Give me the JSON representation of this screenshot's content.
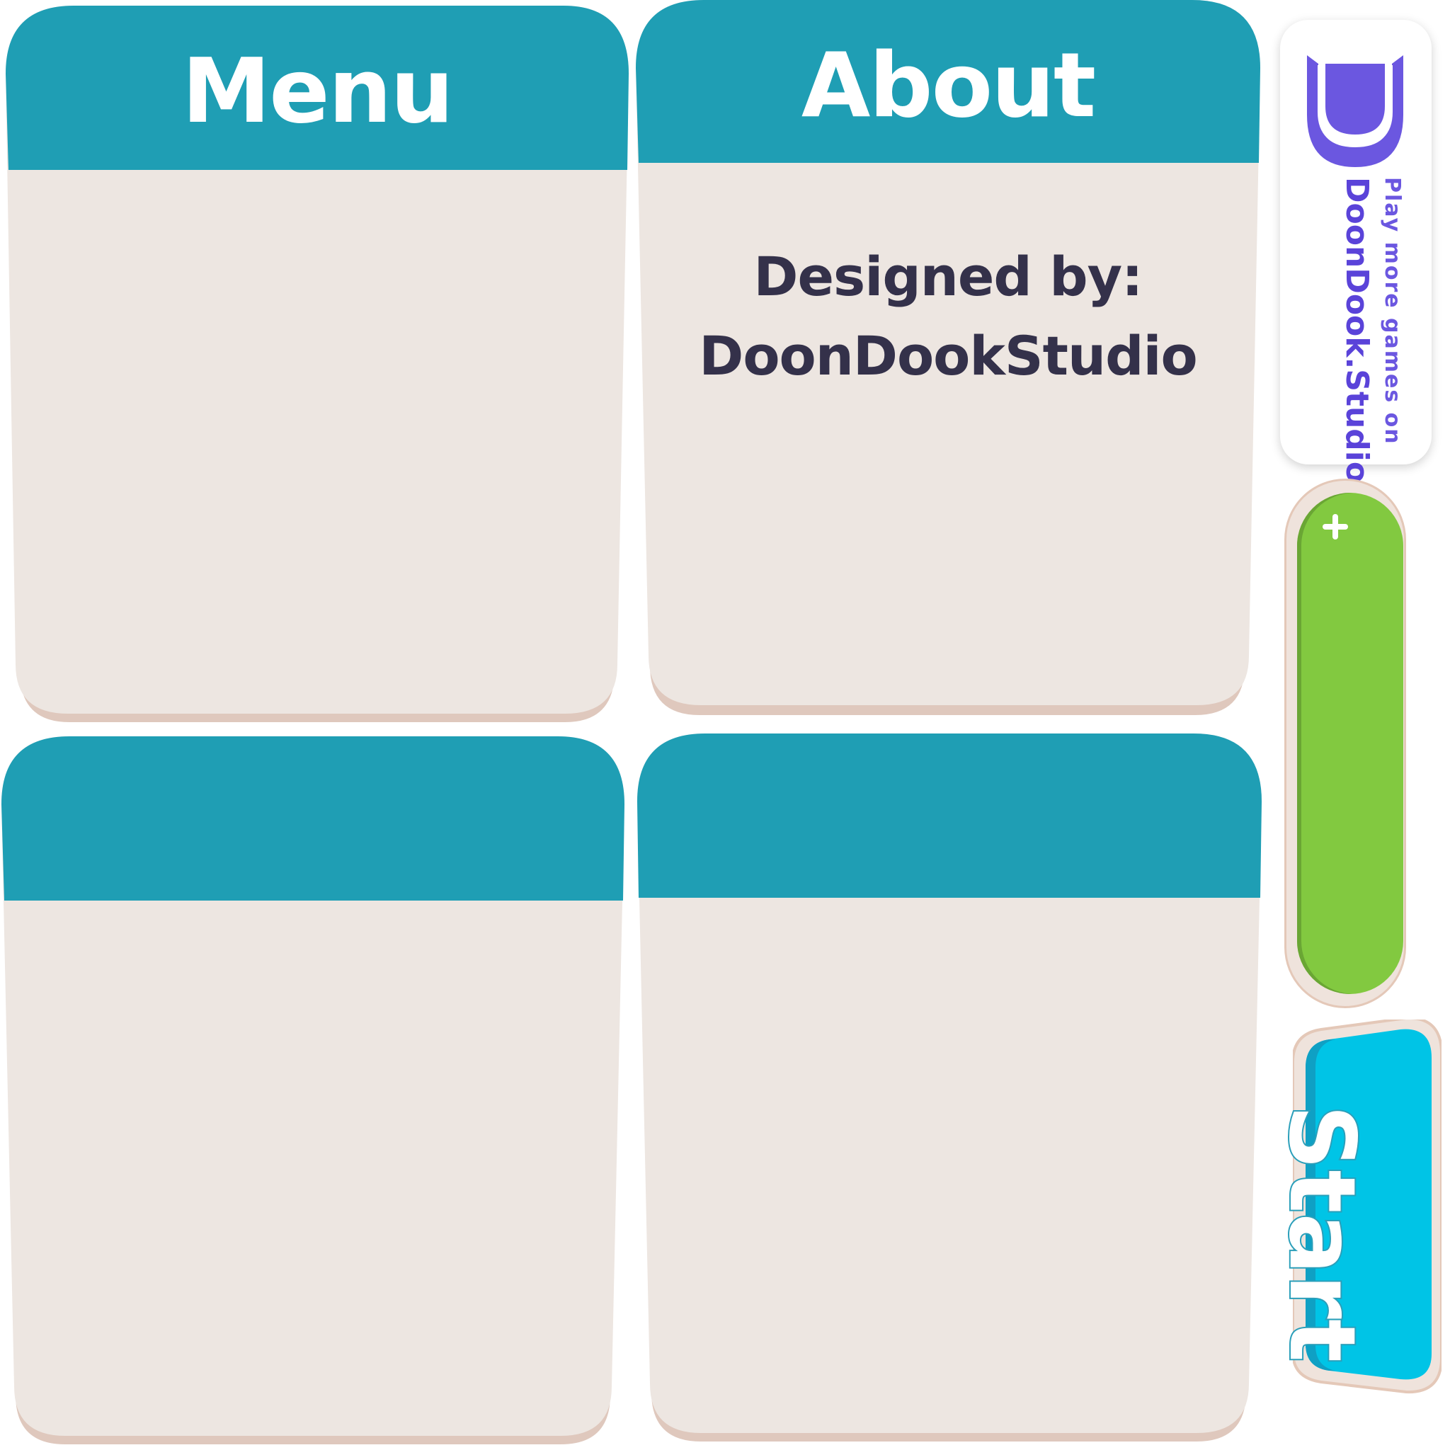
{
  "panels": {
    "menu": {
      "title": "Menu"
    },
    "about": {
      "title": "About",
      "designed_line1": "Designed by:",
      "designed_line2": "DoonDookStudio"
    },
    "panel_bottom_left": {
      "title": ""
    },
    "panel_bottom_right": {
      "title": ""
    }
  },
  "promo": {
    "line1": "Play more games on",
    "line2": "DoonDook.Studio"
  },
  "side_button": {
    "icon": "plus-icon"
  },
  "start_button": {
    "label": "Start"
  },
  "colors": {
    "header_teal": "#1f9eb4",
    "panel_body": "#ede6e1",
    "panel_shadow": "#dfc8bd",
    "text_dark": "#34314a",
    "green": "#82c940",
    "start_cyan": "#00c4e6",
    "brand_purple": "#6b57e0"
  }
}
